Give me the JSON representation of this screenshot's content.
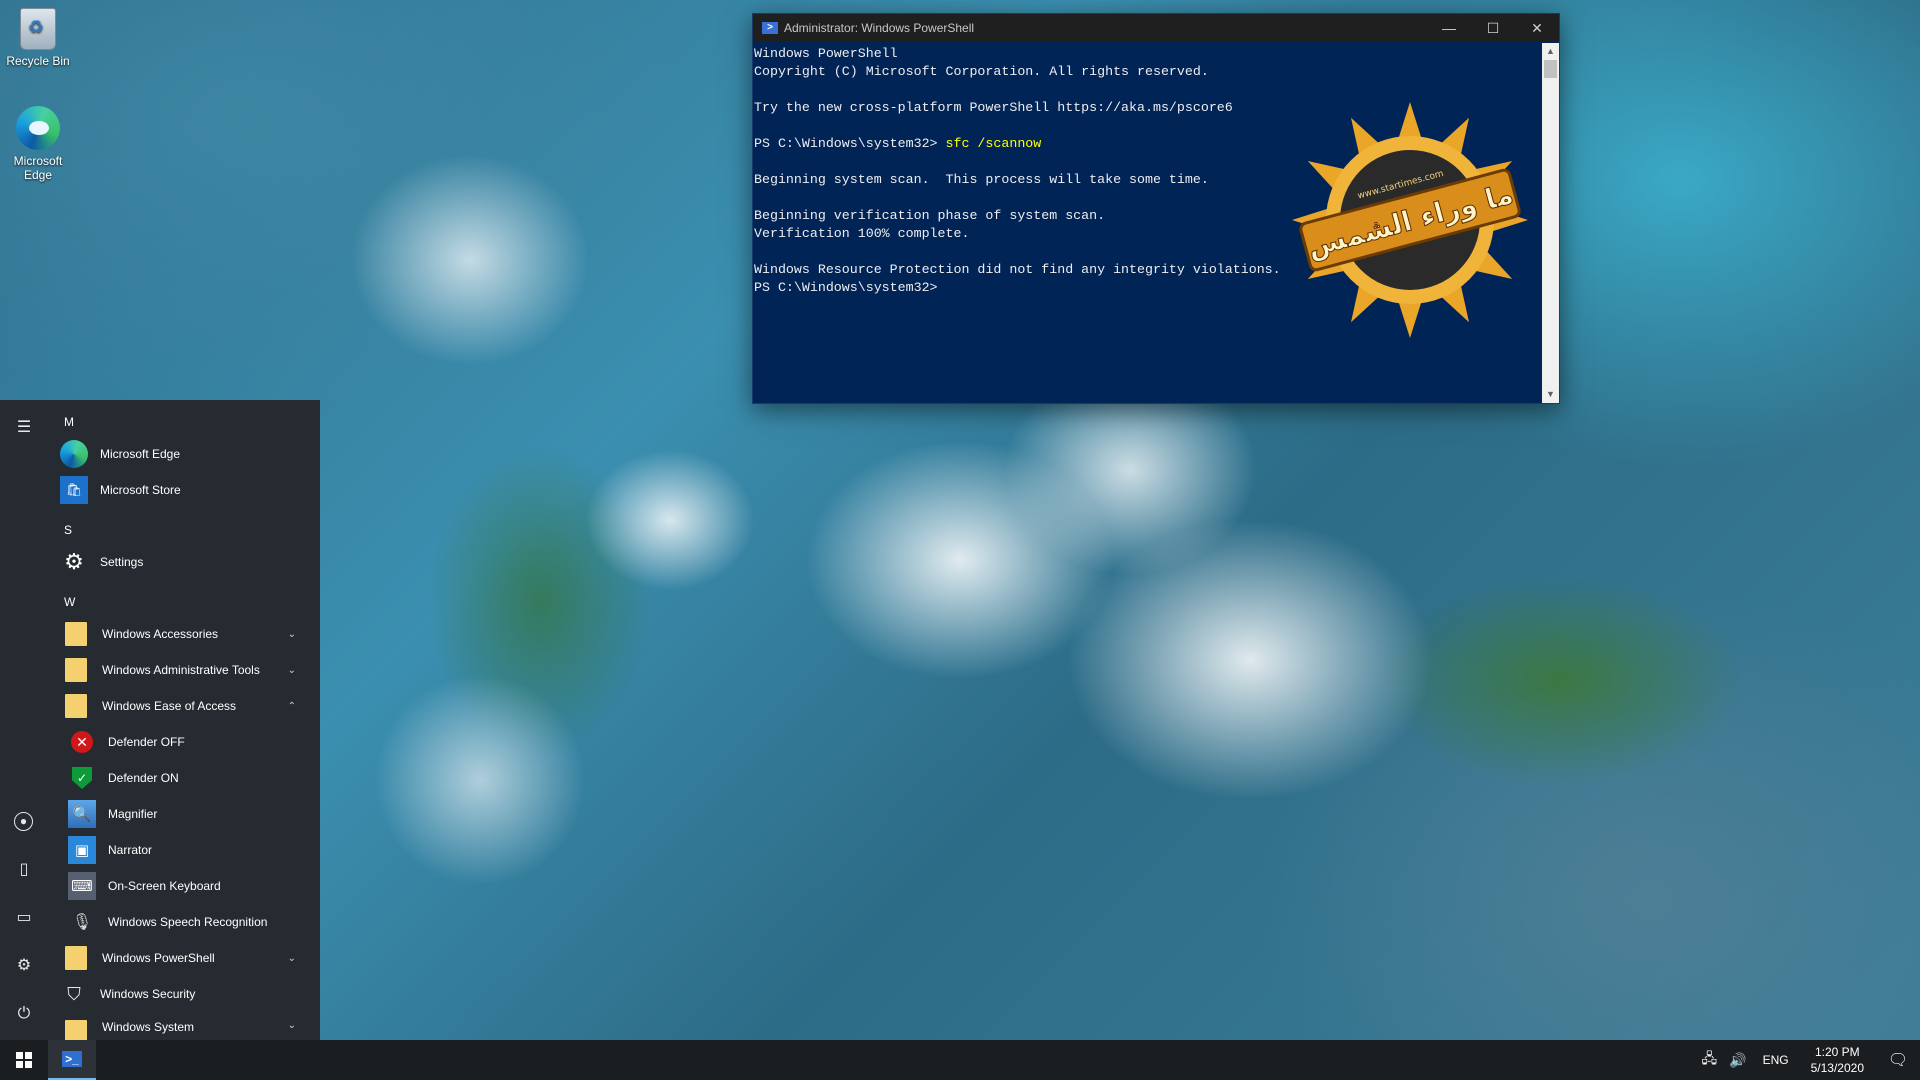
{
  "desktop": {
    "icons": [
      {
        "label": "Recycle Bin",
        "icon": "recycle-bin-icon"
      },
      {
        "label": "Microsoft Edge",
        "icon": "edge-icon"
      }
    ]
  },
  "powershell": {
    "title": "Administrator: Windows PowerShell",
    "controls": {
      "minimize": "—",
      "maximize": "☐",
      "close": "✕"
    },
    "lines": [
      "Windows PowerShell",
      "Copyright (C) Microsoft Corporation. All rights reserved.",
      "",
      "Try the new cross-platform PowerShell https://aka.ms/pscore6",
      "",
      "PS C:\\Windows\\system32> ",
      "",
      "Beginning system scan.  This process will take some time.",
      "",
      "Beginning verification phase of system scan.",
      "Verification 100% complete.",
      "",
      "Windows Resource Protection did not find any integrity violations.",
      "PS C:\\Windows\\system32>"
    ],
    "command": "sfc /scannow",
    "colors": {
      "background": "#012456",
      "text": "#eeedf0",
      "command": "#ffff00"
    }
  },
  "watermark": {
    "text": "ما وراء الشمس",
    "url": "www.startimes.com"
  },
  "start_menu": {
    "sections": [
      {
        "letter": "M",
        "apps": [
          {
            "label": "Microsoft Edge",
            "icon": "edge-icon"
          },
          {
            "label": "Microsoft Store",
            "icon": "store-icon"
          }
        ]
      },
      {
        "letter": "S",
        "apps": [
          {
            "label": "Settings",
            "icon": "gear-icon"
          }
        ]
      },
      {
        "letter": "W",
        "apps": [
          {
            "label": "Windows Accessories",
            "icon": "folder-icon",
            "chevron": "down"
          },
          {
            "label": "Windows Administrative Tools",
            "icon": "folder-icon",
            "chevron": "down"
          },
          {
            "label": "Windows Ease of Access",
            "icon": "folder-icon",
            "chevron": "up"
          },
          {
            "label": "Defender OFF",
            "icon": "defender-off-icon",
            "sub": true
          },
          {
            "label": "Defender ON",
            "icon": "defender-on-icon",
            "sub": true
          },
          {
            "label": "Magnifier",
            "icon": "magnifier-icon",
            "sub": true
          },
          {
            "label": "Narrator",
            "icon": "narrator-icon",
            "sub": true
          },
          {
            "label": "On-Screen Keyboard",
            "icon": "keyboard-icon",
            "sub": true
          },
          {
            "label": "Windows Speech Recognition",
            "icon": "microphone-icon",
            "sub": true
          },
          {
            "label": "Windows PowerShell",
            "icon": "folder-icon",
            "chevron": "down"
          },
          {
            "label": "Windows Security",
            "icon": "shield-icon"
          },
          {
            "label": "Windows System",
            "icon": "folder-icon",
            "chevron": "down"
          }
        ]
      }
    ],
    "rail": [
      "hamburger-icon",
      "user-icon",
      "documents-icon",
      "pictures-icon",
      "settings-icon",
      "power-icon"
    ]
  },
  "taskbar": {
    "language": "ENG",
    "time": "1:20 PM",
    "date": "5/13/2020"
  }
}
